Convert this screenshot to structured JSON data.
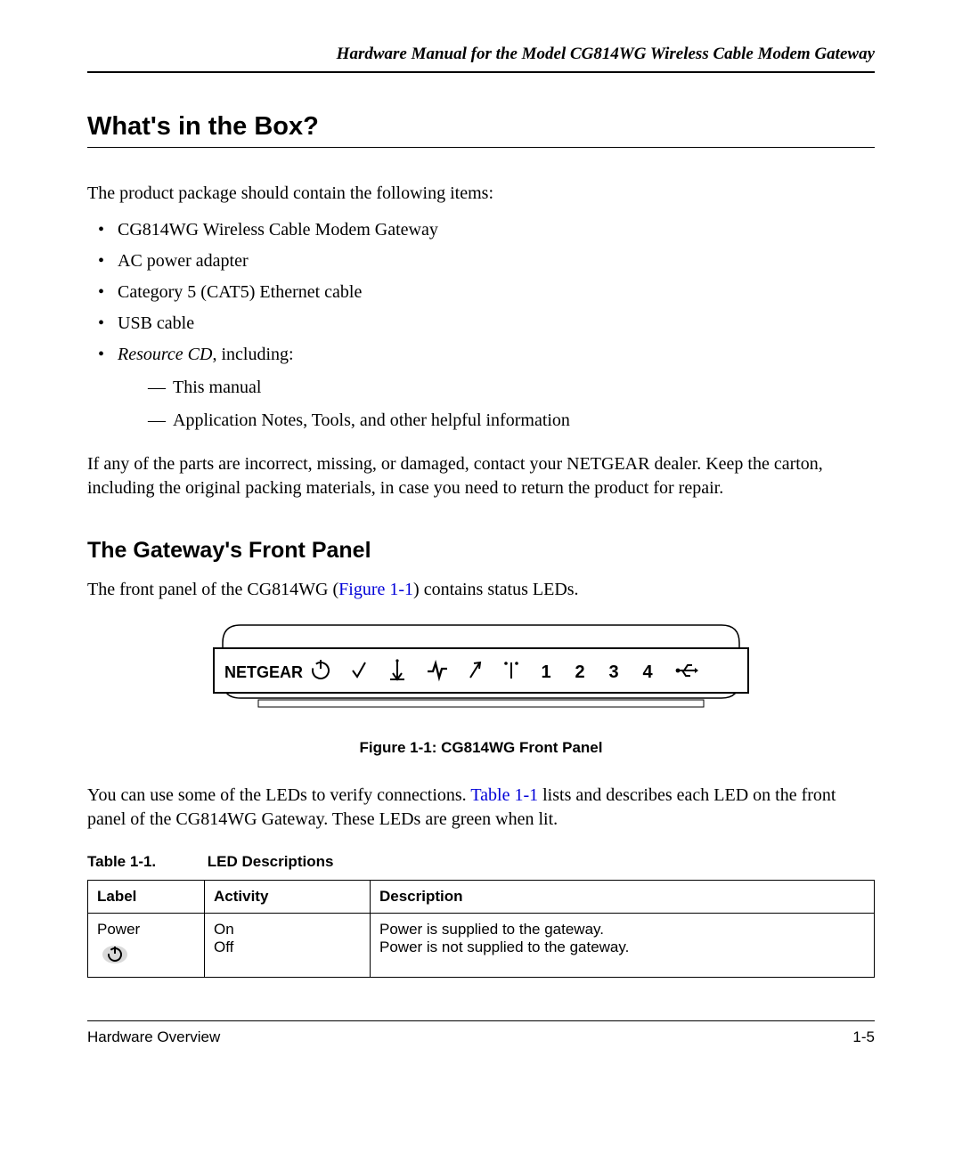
{
  "header": {
    "running_title": "Hardware Manual for the Model CG814WG Wireless Cable Modem Gateway"
  },
  "section1": {
    "title": "What's in the Box?",
    "intro": "The product package should contain the following items:",
    "items": [
      "CG814WG Wireless Cable Modem Gateway",
      "AC power adapter",
      "Category 5 (CAT5) Ethernet cable",
      "USB cable"
    ],
    "resource_label": "Resource CD",
    "resource_suffix": ", including:",
    "subitems": [
      "This manual",
      "Application Notes, Tools, and other helpful information"
    ],
    "closing": "If any of the parts are incorrect, missing, or damaged, contact your NETGEAR dealer. Keep the carton, including the original packing materials, in case you need to return the product for repair."
  },
  "section2": {
    "title": "The Gateway's Front Panel",
    "para1_pre": "The front panel of the CG814WG (",
    "para1_link": "Figure 1-1",
    "para1_post": ") contains status LEDs.",
    "figure_brand": "NETGEAR",
    "figure_labels": {
      "n1": "1",
      "n2": "2",
      "n3": "3",
      "n4": "4"
    },
    "figure_caption": "Figure 1-1:  CG814WG Front Panel",
    "para2_pre": "You can use some of the LEDs to verify connections. ",
    "para2_link": "Table 1-1",
    "para2_post": " lists and describes each LED on the front panel of the CG814WG Gateway. These LEDs are green when lit.",
    "table_caption_label": "Table 1-1.",
    "table_caption_title": "LED Descriptions",
    "table_headers": {
      "label": "Label",
      "activity": "Activity",
      "description": "Description"
    },
    "rows": [
      {
        "label": "Power",
        "activity_line1": "On",
        "activity_line2": "Off",
        "desc_line1": "Power is supplied to the gateway.",
        "desc_line2": "Power is not supplied to the gateway."
      }
    ]
  },
  "footer": {
    "left": "Hardware Overview",
    "right": "1-5"
  }
}
